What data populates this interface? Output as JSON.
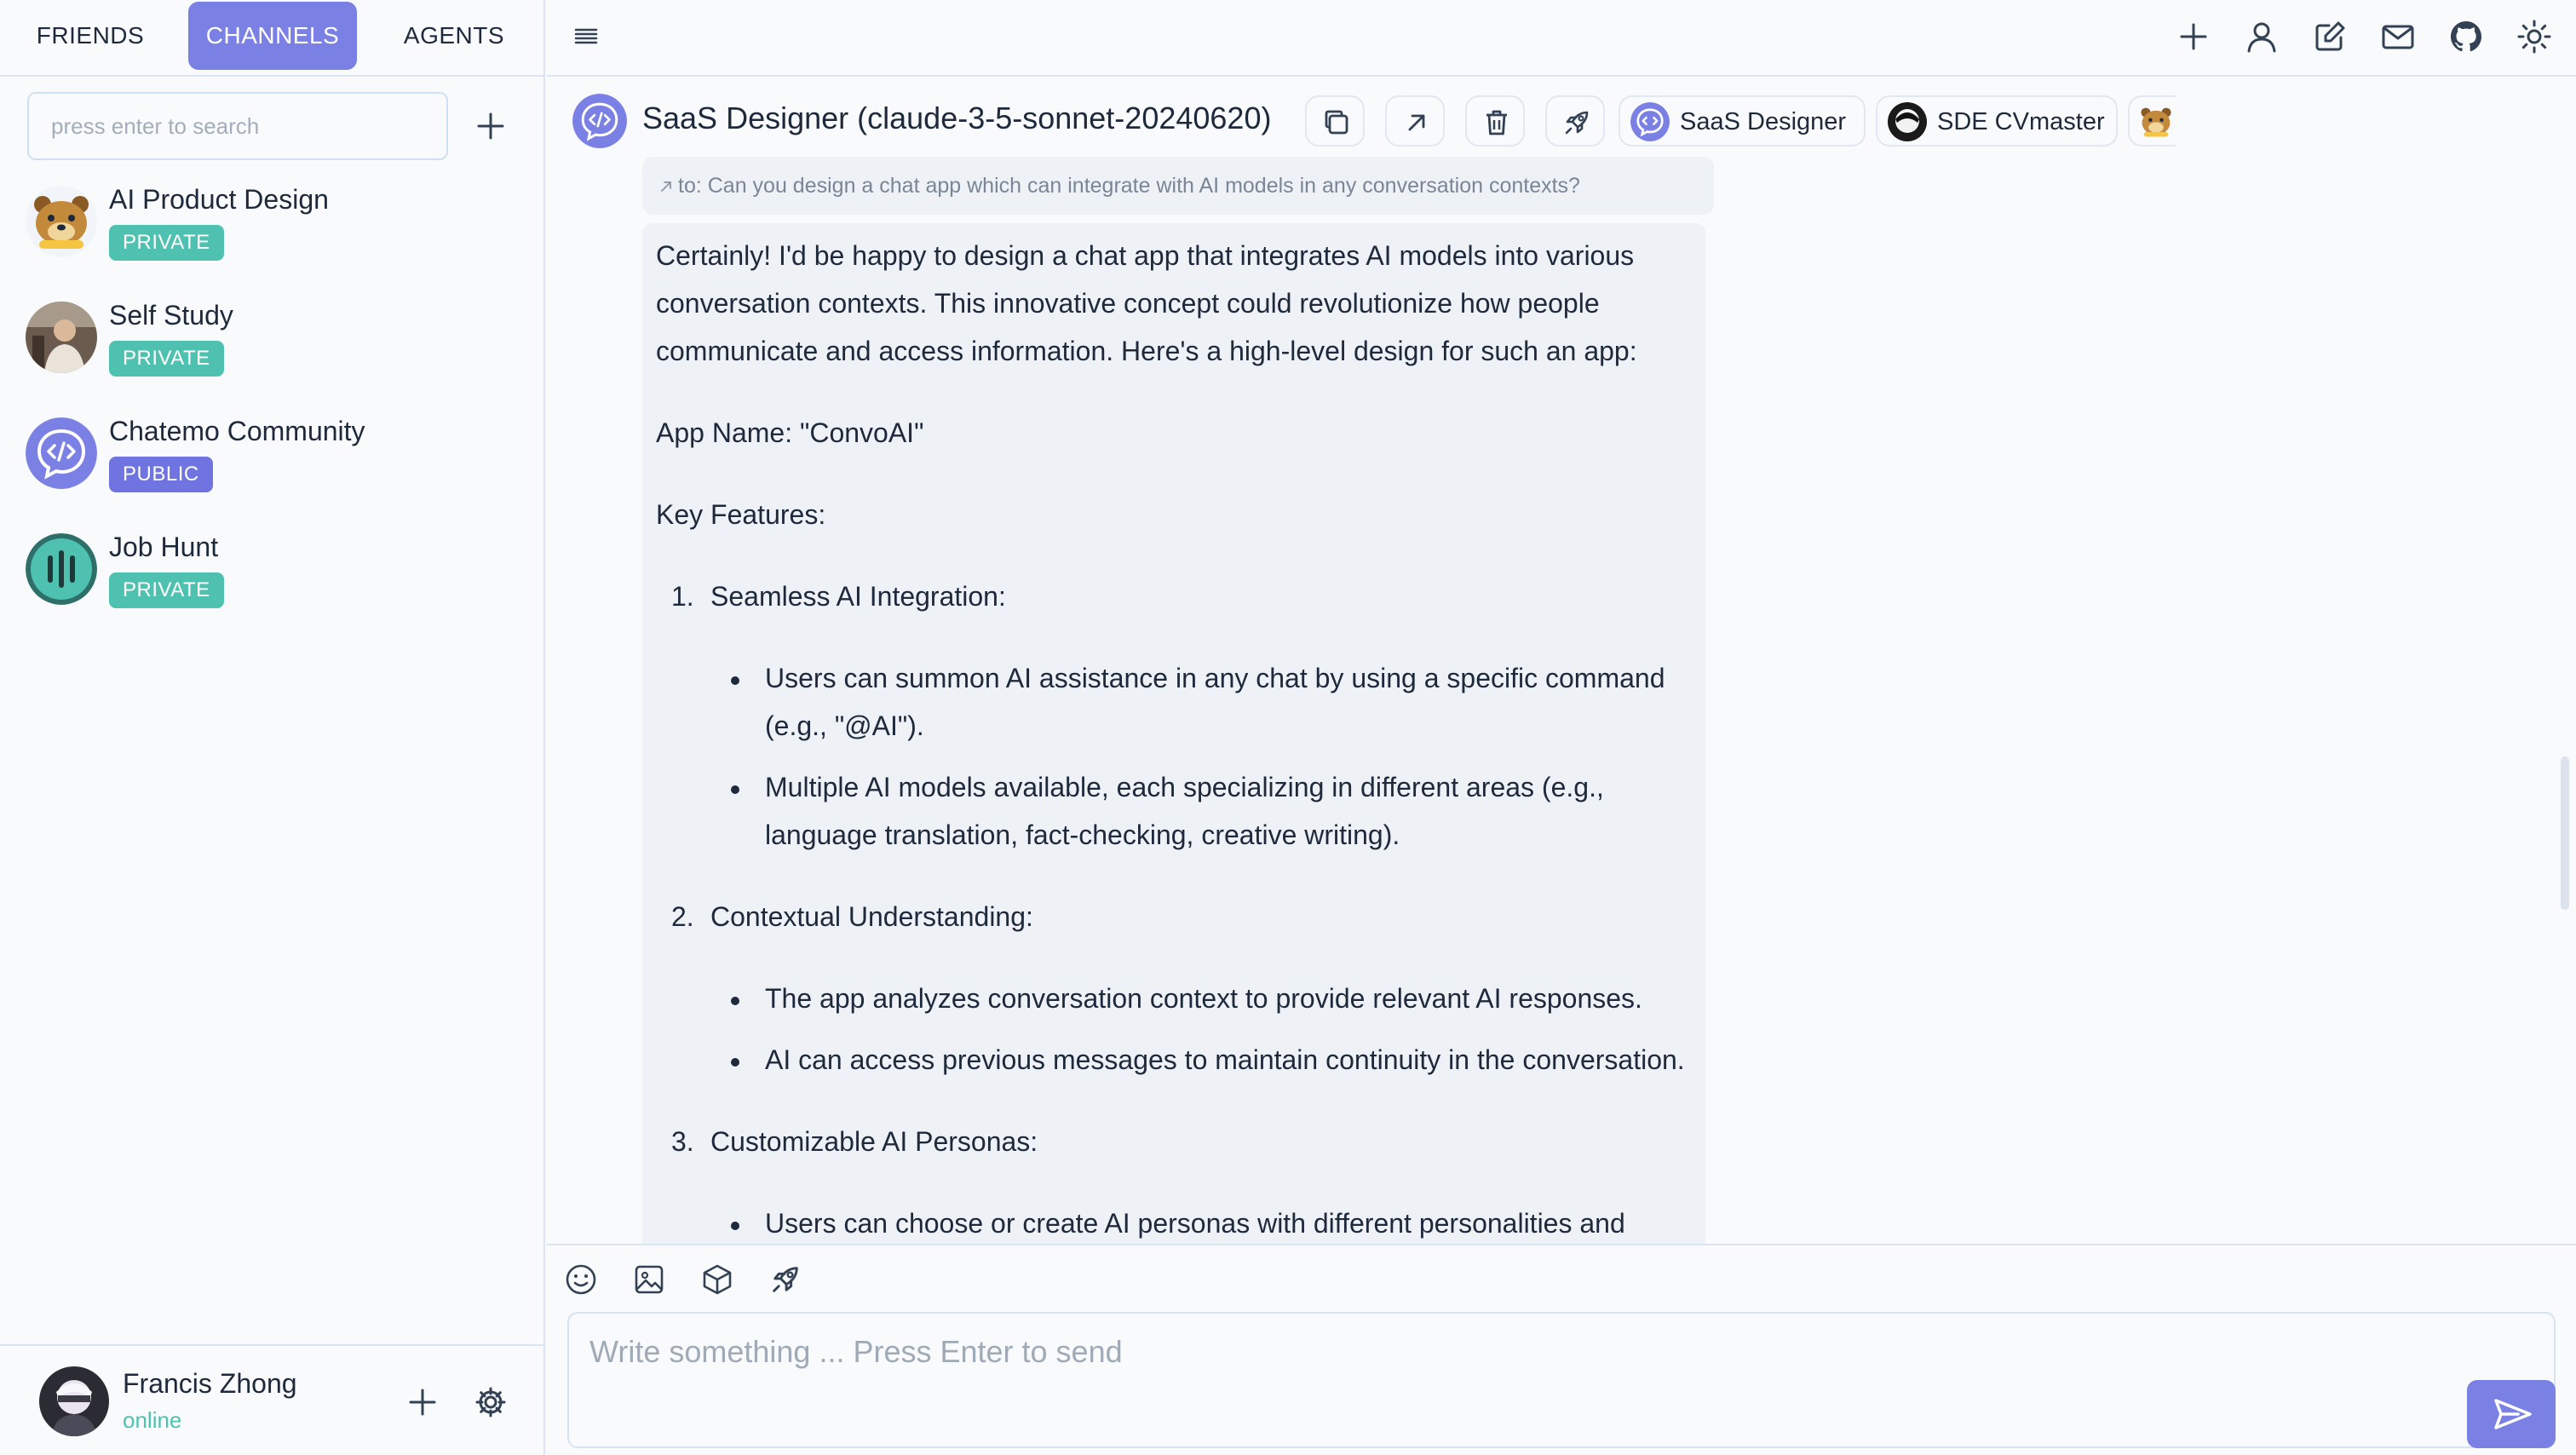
{
  "colors": {
    "accent": "#7b80e4",
    "private_badge": "#4fc1b1",
    "public_badge": "#6f74e0",
    "online": "#4fc1b1"
  },
  "nav": {
    "tabs": [
      "FRIENDS",
      "CHANNELS",
      "AGENTS"
    ],
    "active_tab": "CHANNELS"
  },
  "search": {
    "placeholder": "press enter to search"
  },
  "channels": [
    {
      "name": "AI Product Design",
      "visibility": "PRIVATE",
      "avatar": "bear-avatar"
    },
    {
      "name": "Self Study",
      "visibility": "PRIVATE",
      "avatar": "photo-avatar"
    },
    {
      "name": "Chatemo Community",
      "visibility": "PUBLIC",
      "avatar": "code-chat-avatar"
    },
    {
      "name": "Job Hunt",
      "visibility": "PRIVATE",
      "avatar": "bars-avatar"
    }
  ],
  "user": {
    "name": "Francis Zhong",
    "status": "online"
  },
  "topbar_icons": [
    "menu-icon",
    "plus-icon",
    "user-icon",
    "edit-icon",
    "mail-icon",
    "github-icon",
    "sun-icon"
  ],
  "chat": {
    "agent_title": "SaaS Designer (claude-3-5-sonnet-20240620)",
    "header_buttons": [
      "copy-icon",
      "arrow-up-right-icon",
      "trash-icon",
      "rocket-icon"
    ],
    "agent_chips": [
      {
        "name": "SaaS Designer",
        "avatar": "code-chat-avatar"
      },
      {
        "name": "SDE CVmaster",
        "avatar": "photo-avatar"
      },
      {
        "name": "",
        "avatar": "bear-avatar"
      }
    ],
    "reply_ref": "to: Can you design a chat app which can integrate with AI models in any conversation contexts?",
    "message_lines": [
      "Certainly! I'd be happy to design a chat app that integrates AI models into various",
      "conversation contexts. This innovative concept could revolutionize how people",
      "communicate and access information. Here's a high-level design for such an app:",
      "App Name: \"ConvoAI\"",
      "Key Features:",
      "1.",
      "Seamless AI Integration:",
      "Users can summon AI assistance in any chat by using a specific command",
      "(e.g., \"@AI\").",
      "Multiple AI models available, each specializing in different areas (e.g.,",
      "language translation, fact-checking, creative writing).",
      "2.",
      "Contextual Understanding:",
      "The app analyzes conversation context to provide relevant AI responses.",
      "AI can access previous messages to maintain continuity in the conversation.",
      "3.",
      "Customizable AI Personas:",
      "Users can choose or create AI personas with different personalities and"
    ]
  },
  "composer": {
    "toolbar_icons": [
      "smile-icon",
      "image-icon",
      "cube-icon",
      "rocket-icon"
    ],
    "placeholder": "Write something ... Press Enter to send"
  }
}
